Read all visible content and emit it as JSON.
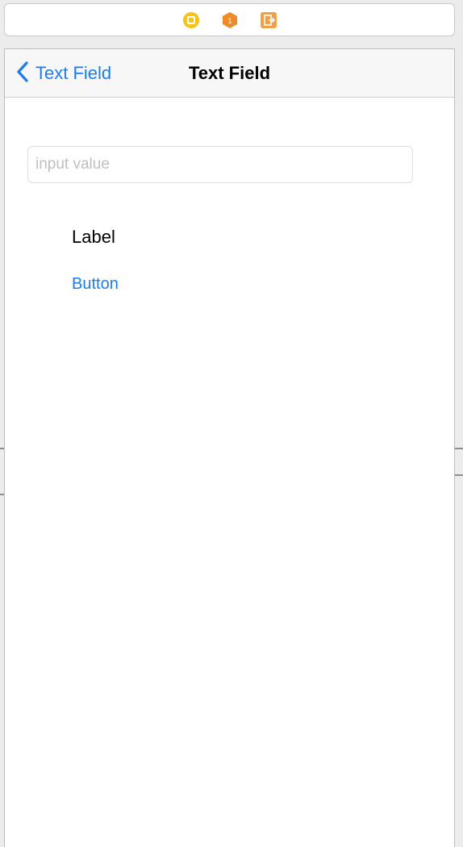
{
  "dock": {
    "icons": [
      "view-controller-icon",
      "first-responder-icon",
      "exit-icon"
    ],
    "colors": {
      "view_controller": "#f5c31a",
      "first_responder": "#f08a24",
      "exit": "#f0a045"
    }
  },
  "nav": {
    "back_label": "Text Field",
    "title": "Text Field"
  },
  "text_field": {
    "placeholder": "input value",
    "value": ""
  },
  "label": {
    "text": "Label"
  },
  "button": {
    "label": "Button"
  },
  "colors": {
    "accent": "#1a7cf0",
    "nav_background": "#f7f7f7"
  }
}
